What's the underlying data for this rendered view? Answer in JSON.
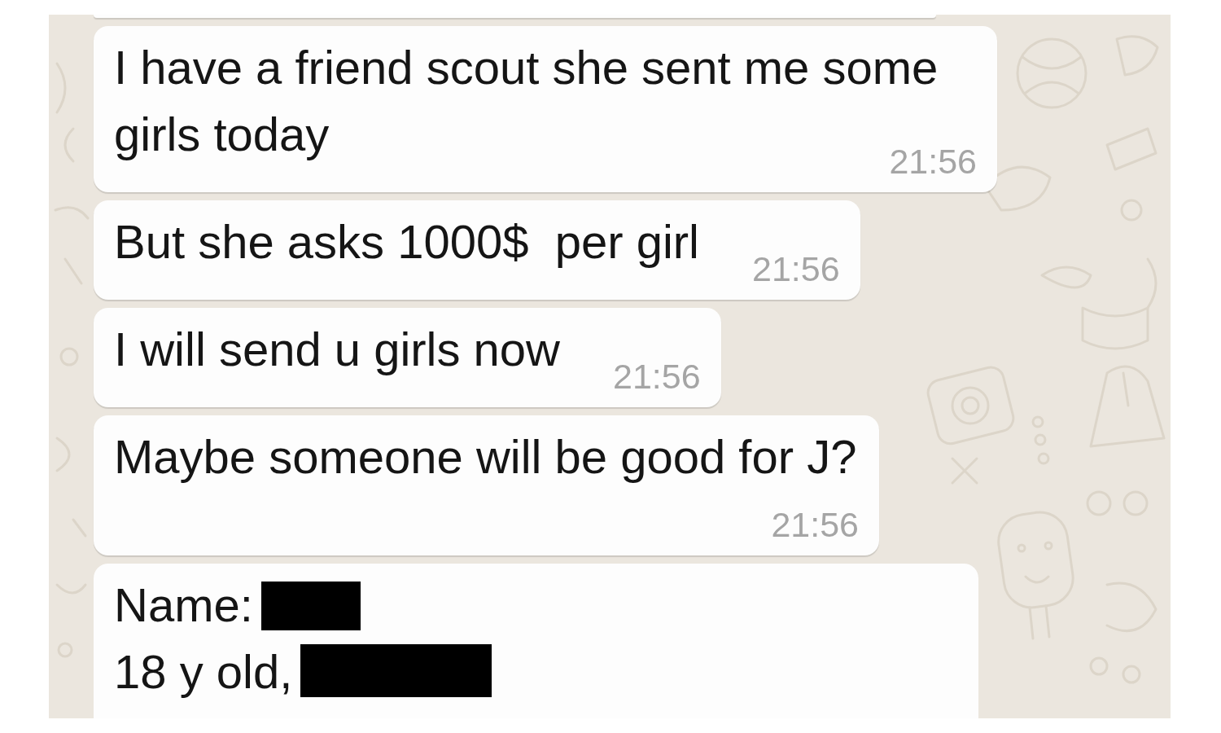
{
  "chat": {
    "messages": [
      {
        "kind": "text",
        "text": "I have a friend scout she sent me some girls today",
        "time": "21:56"
      },
      {
        "kind": "text",
        "text": "But she asks 1000$  per girl",
        "time": "21:56"
      },
      {
        "kind": "text",
        "text": "I will send u girls now",
        "time": "21:56"
      },
      {
        "kind": "text",
        "text": "Maybe someone will be good for J?",
        "time": "21:56"
      },
      {
        "kind": "details",
        "lines": [
          {
            "text": "Name:",
            "redacted": true
          },
          {
            "text": "18 y old,",
            "redacted": true
          }
        ]
      }
    ]
  }
}
